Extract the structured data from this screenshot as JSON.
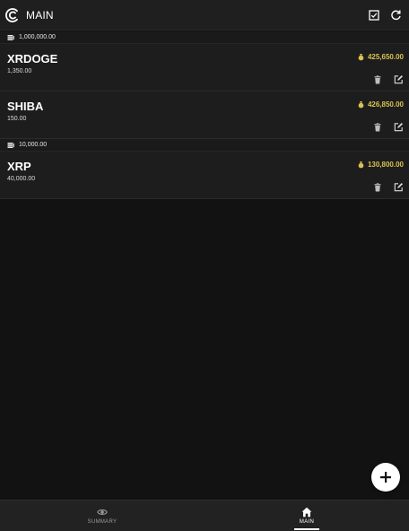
{
  "appbar": {
    "title": "MAIN",
    "icons": {
      "logo": "c-logo-icon",
      "select": "checkbox-icon",
      "refresh": "refresh-icon"
    }
  },
  "groups": [
    {
      "header": "1,000,000.00",
      "icon": "stack-icon",
      "items": [
        {
          "name": "XRDOGE",
          "quantity": "1,350.00",
          "value": "425,650.00"
        },
        {
          "name": "SHIBA",
          "quantity": "150.00",
          "value": "426,850.00"
        }
      ]
    },
    {
      "header": "10,000.00",
      "icon": "stack-icon",
      "items": [
        {
          "name": "XRP",
          "quantity": "40,000.00",
          "value": "130,800.00"
        }
      ]
    }
  ],
  "colors": {
    "background": "#121212",
    "card": "#1d1d1d",
    "value_gold": "#d9c251",
    "accent": "#ffffff"
  },
  "fab": {
    "icon": "plus-icon"
  },
  "bottomnav": {
    "items": [
      {
        "label": "SUMMARY",
        "icon": "eye-icon",
        "active": false
      },
      {
        "label": "MAIN",
        "icon": "home-icon",
        "active": true
      }
    ]
  }
}
